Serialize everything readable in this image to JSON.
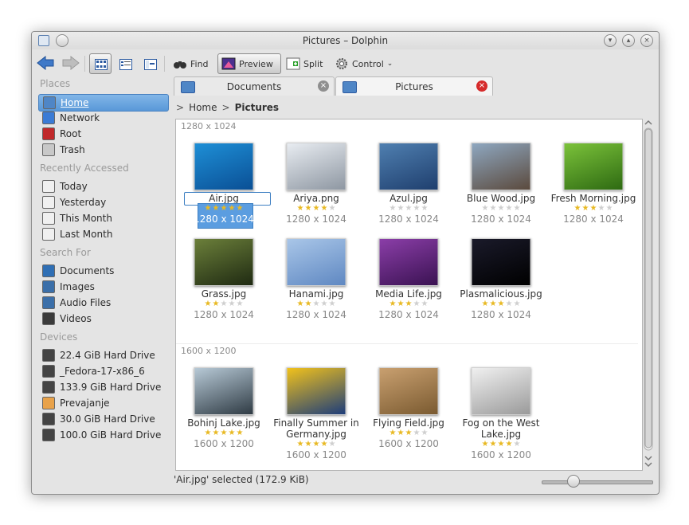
{
  "window": {
    "title": "Pictures – Dolphin"
  },
  "toolbar": {
    "find": "Find",
    "preview": "Preview",
    "split": "Split",
    "control": "Control"
  },
  "places": {
    "sections": [
      {
        "title": "Places",
        "items": [
          {
            "label": "Home",
            "icon": "home-folder-icon",
            "color": "#4f86c6"
          },
          {
            "label": "Network",
            "icon": "globe-icon",
            "color": "#3a7bd5"
          },
          {
            "label": "Root",
            "icon": "red-folder-icon",
            "color": "#c0282a"
          },
          {
            "label": "Trash",
            "icon": "trash-icon",
            "color": "#c8c8c8"
          }
        ]
      },
      {
        "title": "Recently Accessed",
        "items": [
          {
            "label": "Today",
            "icon": "document-icon",
            "color": "#f0f0f0"
          },
          {
            "label": "Yesterday",
            "icon": "document-icon",
            "color": "#f0f0f0"
          },
          {
            "label": "This Month",
            "icon": "document-icon",
            "color": "#f0f0f0"
          },
          {
            "label": "Last Month",
            "icon": "document-icon",
            "color": "#f0f0f0"
          }
        ]
      },
      {
        "title": "Search For",
        "items": [
          {
            "label": "Documents",
            "icon": "text-document-icon",
            "color": "#2f6fb5"
          },
          {
            "label": "Images",
            "icon": "image-icon",
            "color": "#3b6fa9"
          },
          {
            "label": "Audio Files",
            "icon": "audio-icon",
            "color": "#3b6fa9"
          },
          {
            "label": "Videos",
            "icon": "video-icon",
            "color": "#3b3b3b"
          }
        ]
      },
      {
        "title": "Devices",
        "items": [
          {
            "label": "22.4 GiB Hard Drive",
            "icon": "hard-drive-icon",
            "color": "#444"
          },
          {
            "label": "_Fedora-17-x86_6",
            "icon": "disc-icon",
            "color": "#444"
          },
          {
            "label": "133.9 GiB Hard Drive",
            "icon": "hard-drive-icon",
            "color": "#444"
          },
          {
            "label": "Prevajanje",
            "icon": "usb-drive-icon",
            "color": "#e8a24a"
          },
          {
            "label": "30.0 GiB Hard Drive",
            "icon": "hard-drive-icon",
            "color": "#444"
          },
          {
            "label": "100.0 GiB Hard Drive",
            "icon": "hard-drive-icon",
            "color": "#444"
          }
        ]
      }
    ]
  },
  "tabs": [
    {
      "label": "Documents",
      "active": false
    },
    {
      "label": "Pictures",
      "active": true
    }
  ],
  "breadcrumb": {
    "home": "Home",
    "current": "Pictures"
  },
  "groups": [
    {
      "title": "1280 x 1024",
      "items": [
        {
          "name": "Air.jpg",
          "rating": 5,
          "res": "1280 x 1024",
          "selected": true,
          "colors": [
            "#1e8fd6",
            "#0a4f95"
          ]
        },
        {
          "name": "Ariya.png",
          "rating": 4,
          "res": "1280 x 1024",
          "colors": [
            "#e8ecf1",
            "#8e97a2"
          ]
        },
        {
          "name": "Azul.jpg",
          "rating": 0,
          "res": "1280 x 1024",
          "colors": [
            "#4f7fb0",
            "#1f3f6e"
          ]
        },
        {
          "name": "Blue Wood.jpg",
          "rating": 0,
          "res": "1280 x 1024",
          "colors": [
            "#8ea7c0",
            "#5b4a3d"
          ]
        },
        {
          "name": "Fresh Morning.jpg",
          "rating": 3,
          "res": "1280 x 1024",
          "colors": [
            "#7bc23a",
            "#2e6a12"
          ]
        },
        {
          "name": "Grass.jpg",
          "rating": 2,
          "res": "1280 x 1024",
          "colors": [
            "#6b7f3a",
            "#1f2a12"
          ]
        },
        {
          "name": "Hanami.jpg",
          "rating": 2,
          "res": "1280 x 1024",
          "colors": [
            "#a9c6e8",
            "#5f88c2"
          ]
        },
        {
          "name": "Media Life.jpg",
          "rating": 3,
          "res": "1280 x 1024",
          "colors": [
            "#8b3ea8",
            "#3a1252"
          ]
        },
        {
          "name": "Plasmalicious.jpg",
          "rating": 3,
          "res": "1280 x 1024",
          "colors": [
            "#1a1a2a",
            "#000000"
          ]
        }
      ]
    },
    {
      "title": "1600 x 1200",
      "items": [
        {
          "name": "Bohinj Lake.jpg",
          "rating": 5,
          "res": "1600 x 1200",
          "colors": [
            "#b7c9d6",
            "#2f3b44"
          ]
        },
        {
          "name": "Finally Summer in Germany.jpg",
          "rating": 4,
          "res": "1600 x 1200",
          "colors": [
            "#f2c21b",
            "#1d3d7a"
          ]
        },
        {
          "name": "Flying Field.jpg",
          "rating": 3,
          "res": "1600 x 1200",
          "colors": [
            "#c9a070",
            "#7a5a30"
          ]
        },
        {
          "name": "Fog on the West Lake.jpg",
          "rating": 4,
          "res": "1600 x 1200",
          "colors": [
            "#f0f0f0",
            "#9a9a9a"
          ]
        }
      ]
    }
  ],
  "status": {
    "text": "'Air.jpg' selected (172.9 KiB)",
    "zoom": 0.27
  },
  "colors": {
    "selection": "#5b9de0",
    "star": "#e8b923",
    "star_empty": "#cfcfcf"
  }
}
